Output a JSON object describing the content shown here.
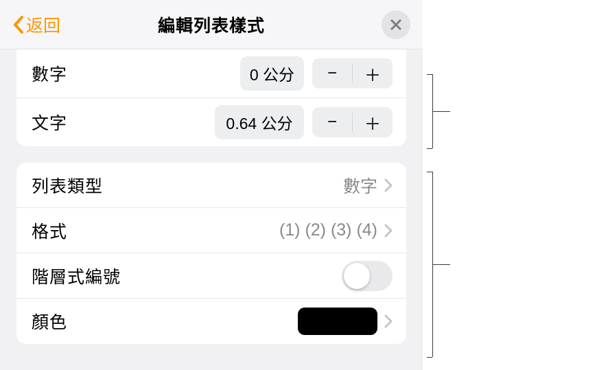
{
  "header": {
    "back_label": "返回",
    "title": "編輯列表樣式"
  },
  "indent": {
    "number_label": "數字",
    "number_value": "0 公分",
    "text_label": "文字",
    "text_value": "0.64 公分"
  },
  "list": {
    "type_label": "列表類型",
    "type_value": "數字",
    "format_label": "格式",
    "format_value": "(1) (2) (3) (4)",
    "tiered_label": "階層式編號",
    "tiered_on": false,
    "color_label": "顏色",
    "color_value": "#000000"
  },
  "glyphs": {
    "minus": "−",
    "plus": "＋"
  }
}
